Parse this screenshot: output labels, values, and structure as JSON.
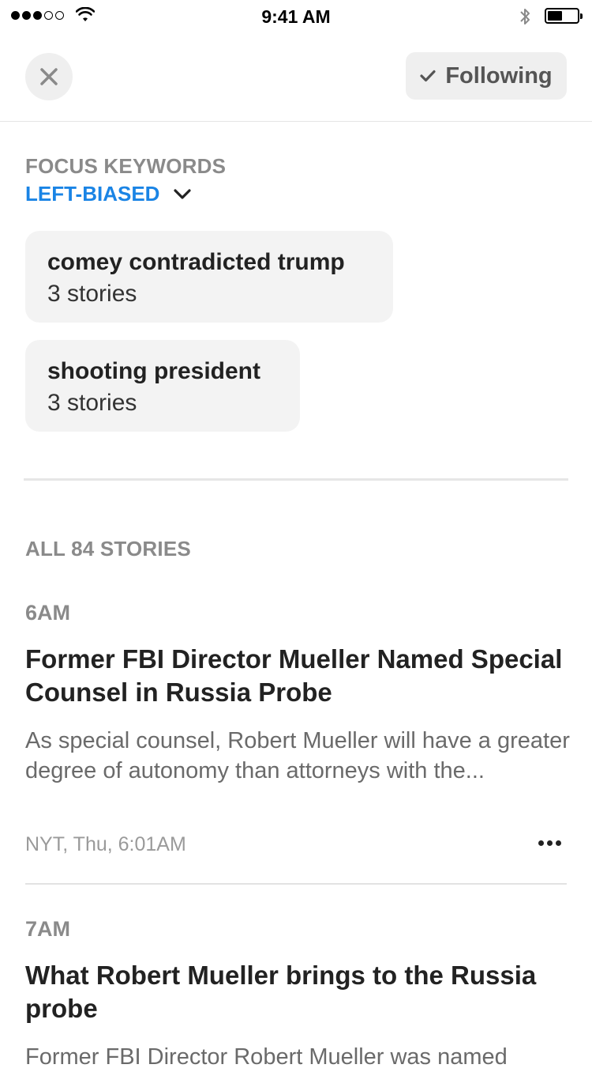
{
  "status_bar": {
    "signal_dots": [
      true,
      true,
      true,
      false,
      false
    ],
    "time": "9:41 AM"
  },
  "header": {
    "follow_label": "Following"
  },
  "focus": {
    "section_label": "FOCUS KEYWORDS",
    "bias_label": "LEFT-BIASED",
    "keywords": [
      {
        "title": "comey contradicted trump",
        "count": "3 stories"
      },
      {
        "title": "shooting president",
        "count": "3 stories"
      }
    ]
  },
  "stories": {
    "section_label": "ALL 84 STORIES",
    "items": [
      {
        "time": "6AM",
        "headline": "Former FBI Director Mueller Named Special Counsel in Russia Probe",
        "summary": "As special counsel, Robert Mueller will have a greater degree of autonomy than attorneys with the...",
        "meta": "NYT, Thu, 6:01AM"
      },
      {
        "time": "7AM",
        "headline": "What Robert Mueller brings to the Russia probe",
        "summary": "Former FBI Director Robert Mueller was named"
      }
    ]
  },
  "colors": {
    "accent": "#1a84e5",
    "muted": "#8a8a8a",
    "chip_bg": "#f3f3f3"
  },
  "icons": [
    "cellular-signal-icon",
    "wifi-icon",
    "bluetooth-icon",
    "battery-icon",
    "close-icon",
    "checkmark-icon",
    "chevron-down-icon",
    "more-icon"
  ]
}
